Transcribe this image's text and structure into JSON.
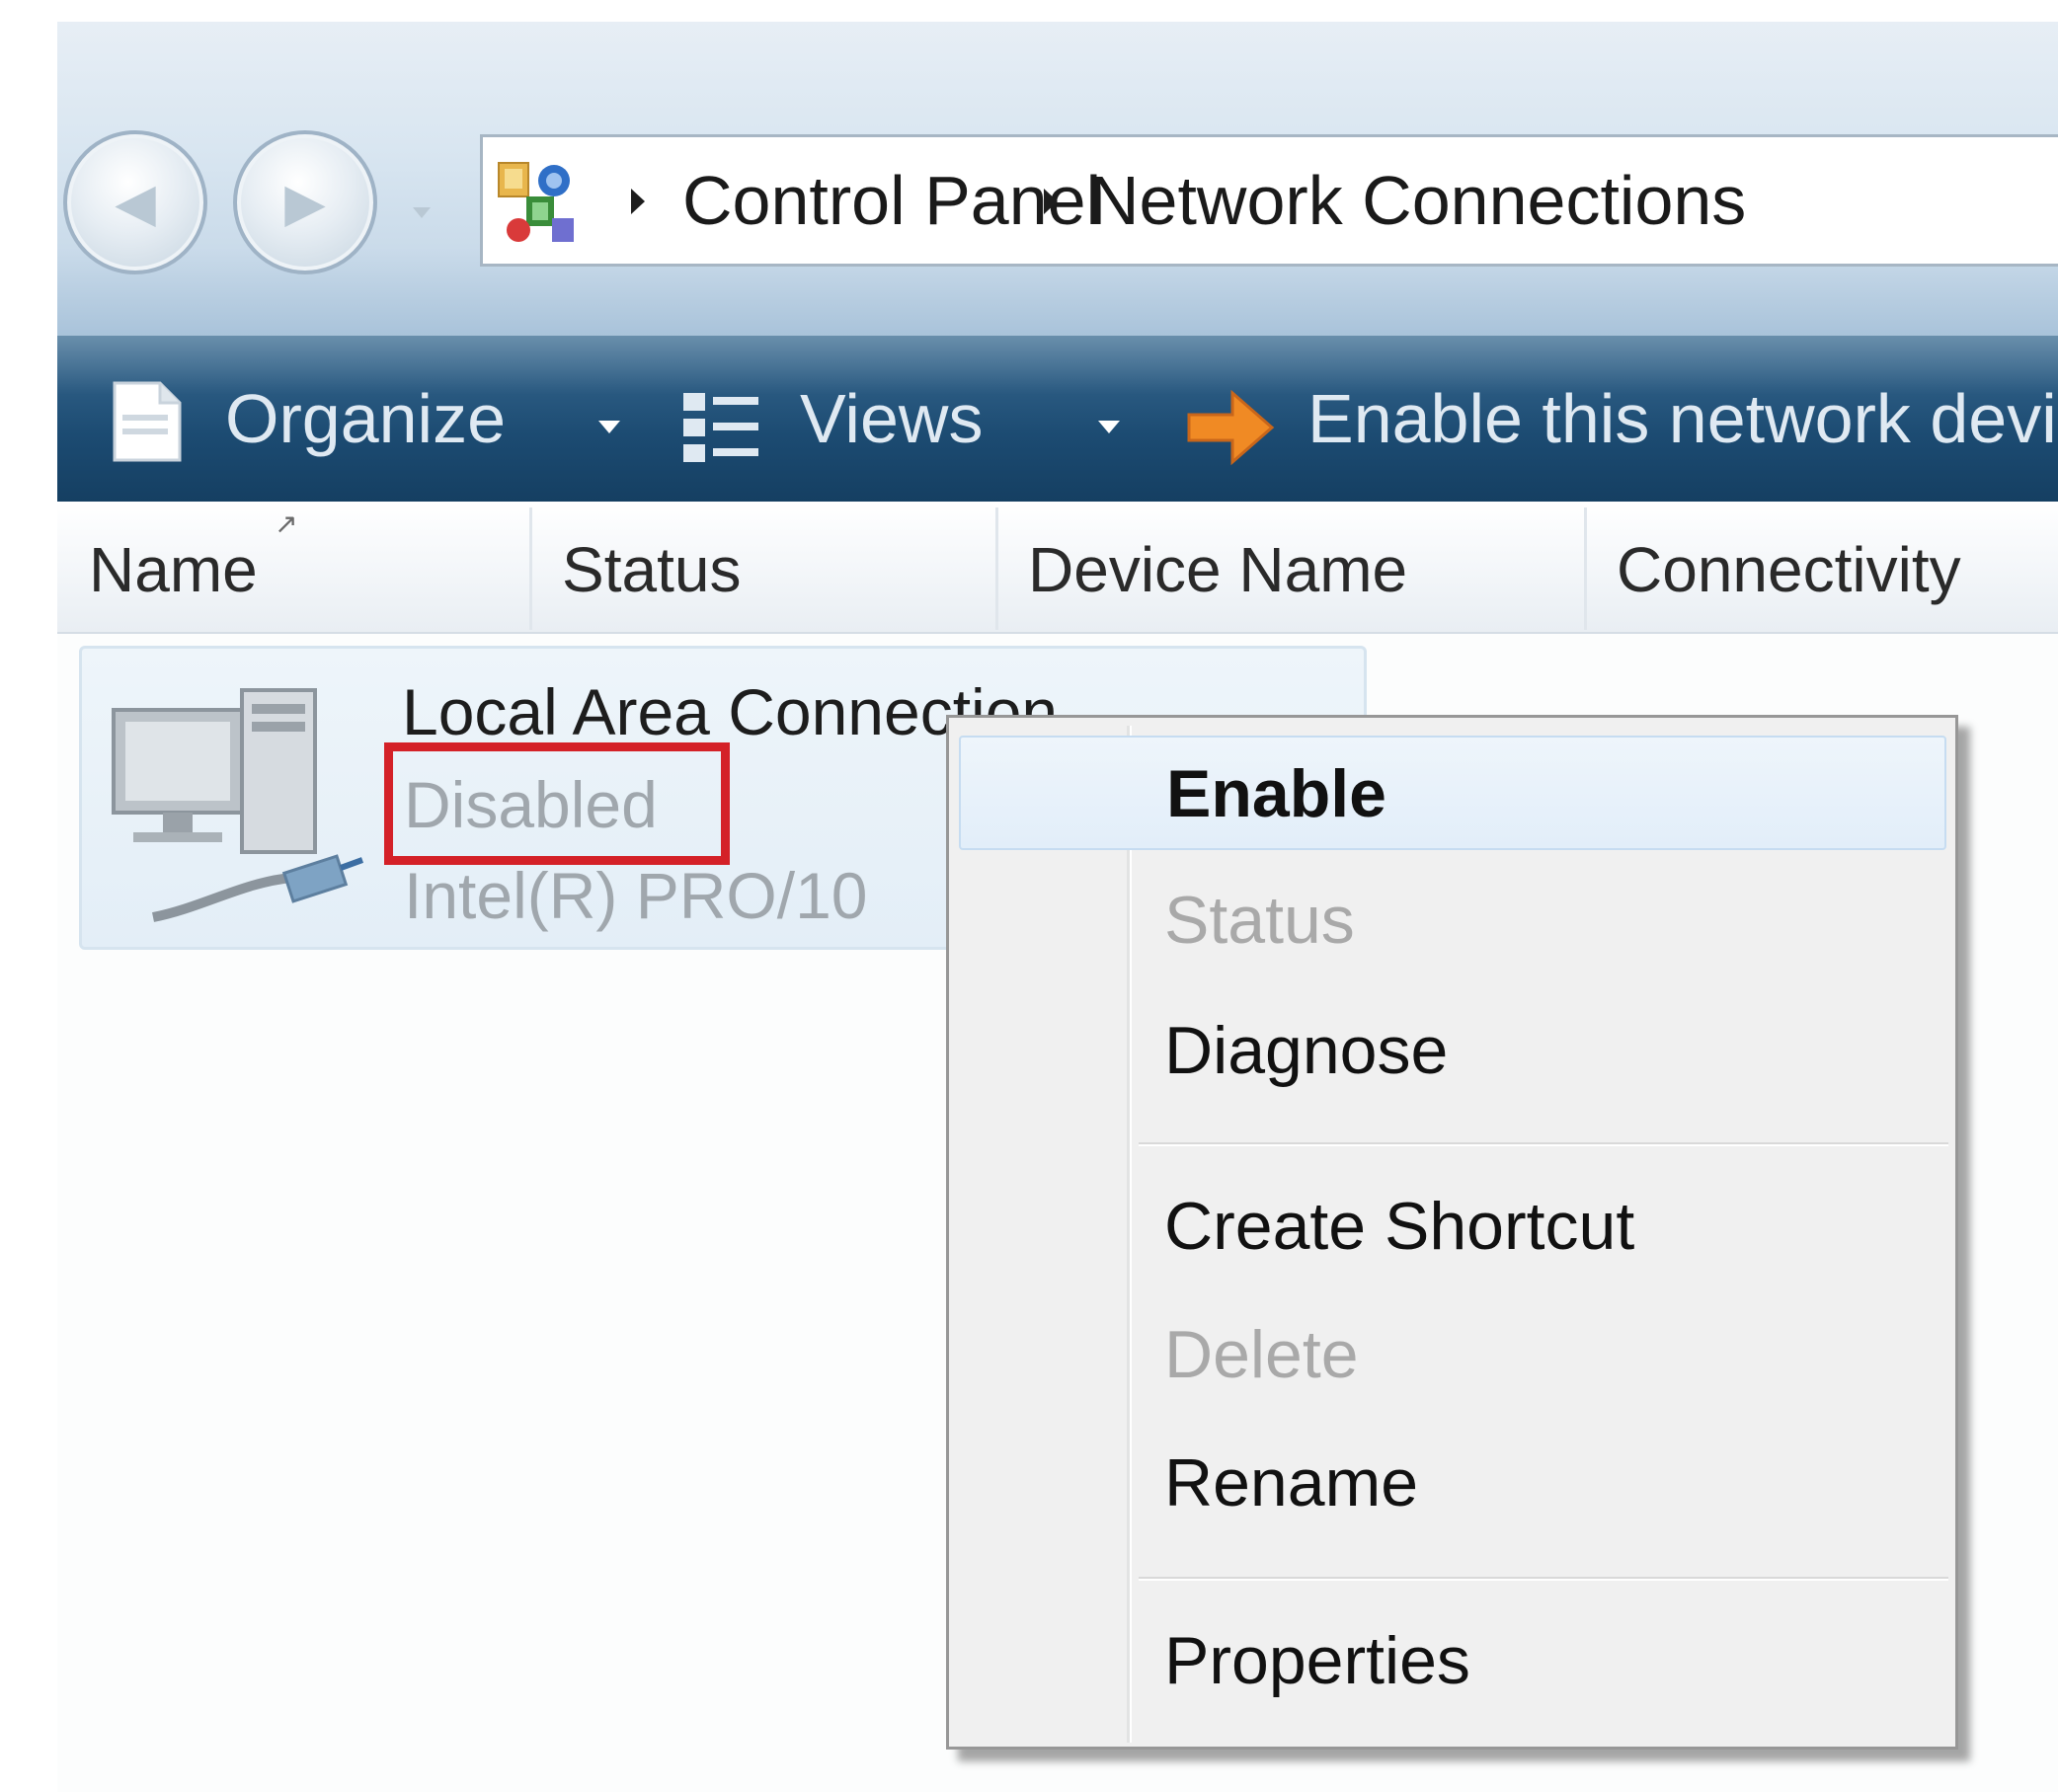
{
  "address_bar": {
    "breadcrumbs": [
      "Control Panel",
      "Network Connections"
    ]
  },
  "toolbar": {
    "organize_label": "Organize",
    "views_label": "Views",
    "enable_device_label": "Enable this network devi"
  },
  "columns": [
    "Name",
    "Status",
    "Device Name",
    "Connectivity"
  ],
  "connection": {
    "name": "Local Area Connection",
    "status": "Disabled",
    "device": "Intel(R) PRO/10"
  },
  "context_menu": {
    "items": [
      {
        "label": "Enable",
        "state": "default"
      },
      {
        "label": "Status",
        "state": "disabled"
      },
      {
        "label": "Diagnose",
        "state": "enabled"
      },
      {
        "label": "Create Shortcut",
        "state": "enabled"
      },
      {
        "label": "Delete",
        "state": "disabled"
      },
      {
        "label": "Rename",
        "state": "enabled"
      },
      {
        "label": "Properties",
        "state": "enabled"
      }
    ]
  },
  "colors": {
    "command_bar": "#1c4b72",
    "highlight_border": "#d42128",
    "disabled_text": "#a9a9a9",
    "menu_background": "#f0f0f0"
  },
  "icons": [
    "back-arrow-icon",
    "forward-arrow-icon",
    "control-panel-icon",
    "organize-icon",
    "views-icon",
    "enable-arrow-icon",
    "network-computer-icon"
  ]
}
